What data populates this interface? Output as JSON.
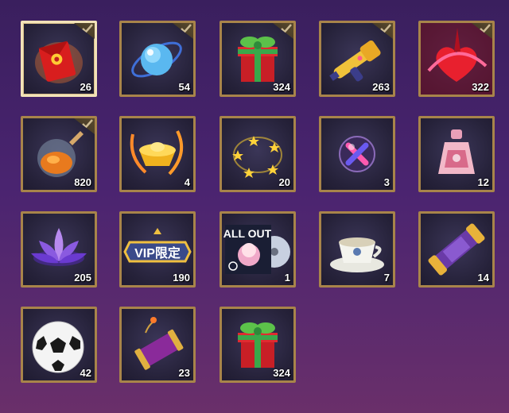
{
  "items": [
    {
      "id": "red-envelope",
      "count": "26",
      "checked": true,
      "selected": true
    },
    {
      "id": "blue-orb",
      "count": "54",
      "checked": true
    },
    {
      "id": "gift-box",
      "count": "324",
      "checked": true
    },
    {
      "id": "water-gun",
      "count": "263",
      "checked": true
    },
    {
      "id": "red-heart-spell",
      "count": "322",
      "checked": true
    },
    {
      "id": "honey-orb",
      "count": "820",
      "checked": true
    },
    {
      "id": "gold-ingot",
      "count": "4"
    },
    {
      "id": "star-ring",
      "count": "20"
    },
    {
      "id": "crossed-orb",
      "count": "3"
    },
    {
      "id": "perfume-bottle",
      "count": "12"
    },
    {
      "id": "purple-lotus",
      "count": "205"
    },
    {
      "id": "vip-badge",
      "count": "190",
      "badge_text": "VIP限定"
    },
    {
      "id": "album",
      "count": "1",
      "album_text": "ALL OUT"
    },
    {
      "id": "tea-cup",
      "count": "7"
    },
    {
      "id": "scroll-tube",
      "count": "14"
    },
    {
      "id": "soccer-ball",
      "count": "42"
    },
    {
      "id": "firecracker",
      "count": "23"
    },
    {
      "id": "gift-box-2",
      "count": "324"
    }
  ],
  "colors": {
    "frame": "#a8844a",
    "selected_frame": "#f2e2b8"
  }
}
